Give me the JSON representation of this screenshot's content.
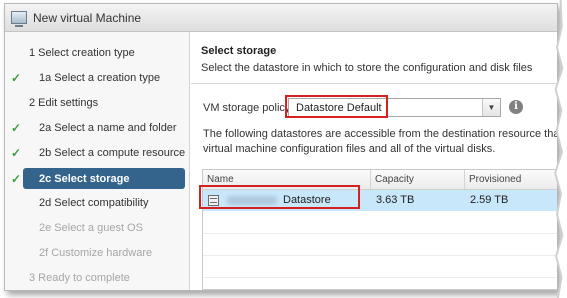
{
  "window": {
    "title": "New virtual Machine"
  },
  "steps": [
    {
      "label": "1  Select creation type",
      "state": "section"
    },
    {
      "label": "1a  Select a creation type",
      "state": "done"
    },
    {
      "label": "2  Edit settings",
      "state": "section"
    },
    {
      "label": "2a  Select a name and folder",
      "state": "done"
    },
    {
      "label": "2b  Select a compute resource",
      "state": "done"
    },
    {
      "label": "2c  Select storage",
      "state": "active"
    },
    {
      "label": "2d  Select compatibility",
      "state": "pending"
    },
    {
      "label": "2e  Select a guest OS",
      "state": "disabled"
    },
    {
      "label": "2f  Customize hardware",
      "state": "disabled"
    },
    {
      "label": "3  Ready to complete",
      "state": "disabled"
    }
  ],
  "content": {
    "title": "Select storage",
    "description": "Select the datastore in which to store the configuration and disk files",
    "policy_label": "VM storage policy:",
    "policy_value": "Datastore Default",
    "info_icon": "i",
    "info_line1": "The following datastores are accessible from the destination resource that you",
    "info_line2": "virtual machine configuration files and all of the virtual disks."
  },
  "table": {
    "columns": [
      "Name",
      "Capacity",
      "Provisioned"
    ],
    "rows": [
      {
        "name": "Datastore",
        "capacity": "3.63 TB",
        "provisioned": "2.59 TB",
        "selected": true
      }
    ]
  },
  "colors": {
    "accent": "#34648c",
    "highlight": "#d42020",
    "selection": "#c9e7fb",
    "check": "#3e9b3e"
  }
}
